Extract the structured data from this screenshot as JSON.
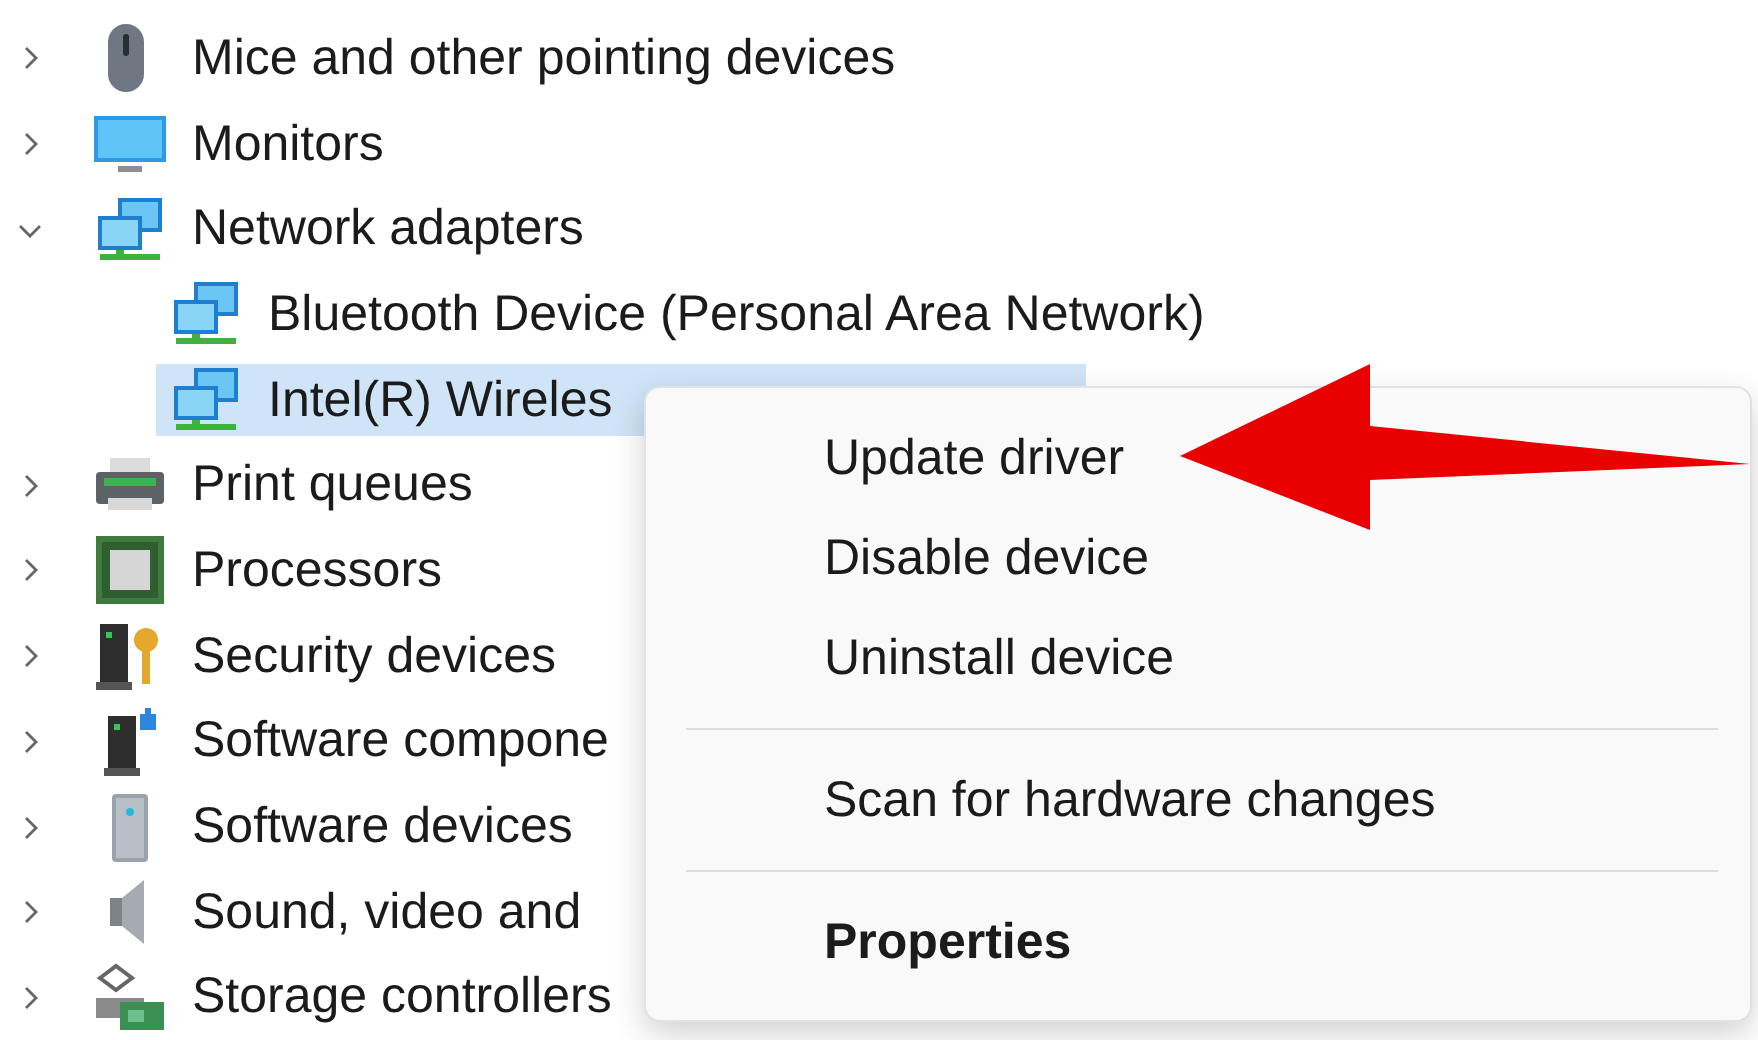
{
  "tree": [
    {
      "label": "Mice and other pointing devices",
      "kind": "mouse",
      "expanded": false,
      "selected": false
    },
    {
      "label": "Monitors",
      "kind": "monitor",
      "expanded": false,
      "selected": false
    },
    {
      "label": "Network adapters",
      "kind": "network",
      "expanded": true,
      "selected": false,
      "children": [
        {
          "label": "Bluetooth Device (Personal Area Network)",
          "kind": "network",
          "selected": false
        },
        {
          "label": "Intel(R) Wireles",
          "kind": "network",
          "selected": true
        }
      ]
    },
    {
      "label": "Print queues",
      "kind": "printer",
      "expanded": false,
      "selected": false
    },
    {
      "label": "Processors",
      "kind": "processor",
      "expanded": false,
      "selected": false
    },
    {
      "label": "Security devices",
      "kind": "security",
      "expanded": false,
      "selected": false
    },
    {
      "label": "Software compone",
      "kind": "component",
      "expanded": false,
      "selected": false
    },
    {
      "label": "Software devices",
      "kind": "software",
      "expanded": false,
      "selected": false
    },
    {
      "label": "Sound, video and",
      "kind": "sound",
      "expanded": false,
      "selected": false
    },
    {
      "label": "Storage controllers",
      "kind": "storage",
      "expanded": false,
      "selected": false
    }
  ],
  "context_menu": {
    "sections": [
      {
        "items": [
          {
            "label": "Update driver",
            "default": false
          },
          {
            "label": "Disable device",
            "default": false
          },
          {
            "label": "Uninstall device",
            "default": false
          }
        ]
      },
      {
        "items": [
          {
            "label": "Scan for hardware changes",
            "default": false
          }
        ]
      },
      {
        "items": [
          {
            "label": "Properties",
            "default": true
          }
        ]
      }
    ]
  }
}
